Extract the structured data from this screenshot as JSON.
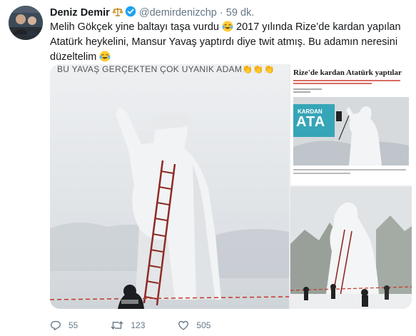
{
  "tweet": {
    "author_name": "Deniz Demir",
    "handle": "@demirdenizchp",
    "separator": "·",
    "time": "59 dk.",
    "text_line1": "Melih Gökçek yine baltayı taşa vurdu",
    "text_line1b": " 2017 yılında Rize’de kardan yapılan",
    "text_line2": "Atatürk heykelini, Mansur Yavaş yaptırdı diye twit atmış. Bu adamın neresini",
    "text_line3": "düzeltelim",
    "icons": {
      "author_badge": "scales-icon",
      "verified": "verified-badge-icon",
      "emoji": "face-with-tears-of-joy-emoji"
    }
  },
  "media": {
    "main_caption": "BU YAVAŞ GERÇEKTEN ÇOK UYANIK ADAM👏👏👏",
    "news_title": "Rize'de kardan Atatürk yaptılar",
    "news_logo_line1": "KARDAN",
    "news_logo_line2": "ATA"
  },
  "actions": {
    "reply_count": "55",
    "retweet_count": "123",
    "like_count": "505"
  },
  "colors": {
    "text": "#14171a",
    "secondary": "#657786",
    "verified": "#1da1f2",
    "link": "#1da1f2"
  }
}
